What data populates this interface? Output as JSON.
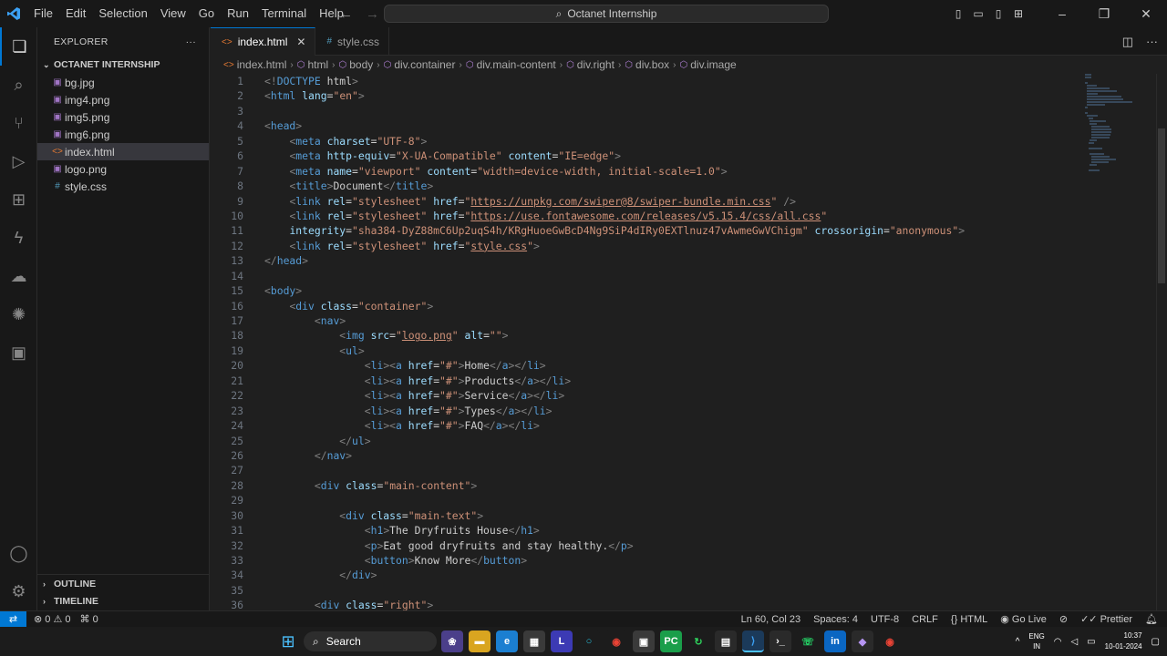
{
  "menu": [
    "File",
    "Edit",
    "Selection",
    "View",
    "Go",
    "Run",
    "Terminal",
    "Help"
  ],
  "command_center": "Octanet Internship",
  "sidebar": {
    "header": "EXPLORER",
    "folder": "OCTANET INTERNSHIP",
    "files": [
      {
        "name": "bg.jpg",
        "type": "img"
      },
      {
        "name": "img4.png",
        "type": "img"
      },
      {
        "name": "img5.png",
        "type": "img"
      },
      {
        "name": "img6.png",
        "type": "img"
      },
      {
        "name": "index.html",
        "type": "html",
        "active": true
      },
      {
        "name": "logo.png",
        "type": "img"
      },
      {
        "name": "style.css",
        "type": "css"
      }
    ],
    "outline": "OUTLINE",
    "timeline": "TIMELINE"
  },
  "tabs": [
    {
      "label": "index.html",
      "icon": "html-file-icon",
      "active": true
    },
    {
      "label": "style.css",
      "icon": "css-file-icon",
      "active": false
    }
  ],
  "breadcrumb": [
    "index.html",
    "html",
    "body",
    "div.container",
    "div.main-content",
    "div.right",
    "div.box",
    "div.image"
  ],
  "code_lines": [
    "<!DOCTYPE html>",
    "<html lang=\"en\">",
    "",
    "<head>",
    "    <meta charset=\"UTF-8\">",
    "    <meta http-equiv=\"X-UA-Compatible\" content=\"IE=edge\">",
    "    <meta name=\"viewport\" content=\"width=device-width, initial-scale=1.0\">",
    "    <title>Document</title>",
    "    <link rel=\"stylesheet\" href=\"https://unpkg.com/swiper@8/swiper-bundle.min.css\" />",
    "    <link rel=\"stylesheet\" href=\"https://use.fontawesome.com/releases/v5.15.4/css/all.css\"",
    "    integrity=\"sha384-DyZ88mC6Up2uqS4h/KRgHuoeGwBcD4Ng9SiP4dIRy0EXTlnuz47vAwmeGwVChigm\" crossorigin=\"anonymous\">",
    "    <link rel=\"stylesheet\" href=\"style.css\">",
    "</head>",
    "",
    "<body>",
    "    <div class=\"container\">",
    "        <nav>",
    "            <img src=\"logo.png\" alt=\"\">",
    "            <ul>",
    "                <li><a href=\"#\">Home</a></li>",
    "                <li><a href=\"#\">Products</a></li>",
    "                <li><a href=\"#\">Service</a></li>",
    "                <li><a href=\"#\">Types</a></li>",
    "                <li><a href=\"#\">FAQ</a></li>",
    "            </ul>",
    "        </nav>",
    "",
    "        <div class=\"main-content\">",
    "",
    "            <div class=\"main-text\">",
    "                <h1>The Dryfruits House</h1>",
    "                <p>Eat good dryfruits and stay healthy.</p>",
    "                <button>Know More</button>",
    "            </div>",
    "",
    "        <div class=\"right\">"
  ],
  "status": {
    "errors": "0",
    "warnings": "0",
    "ports": "0",
    "position": "Ln 60, Col 23",
    "spaces": "Spaces: 4",
    "encoding": "UTF-8",
    "eol": "CRLF",
    "language": "HTML",
    "go_live": "Go Live",
    "prettier": "Prettier"
  },
  "taskbar": {
    "search": "Search",
    "lang_top": "ENG",
    "lang_bottom": "IN",
    "time": "10:37",
    "date": "10-01-2024"
  },
  "colors": {
    "accent": "#0078d4",
    "tag": "#569cd6",
    "attr": "#9cdcfe",
    "string": "#ce9178"
  }
}
